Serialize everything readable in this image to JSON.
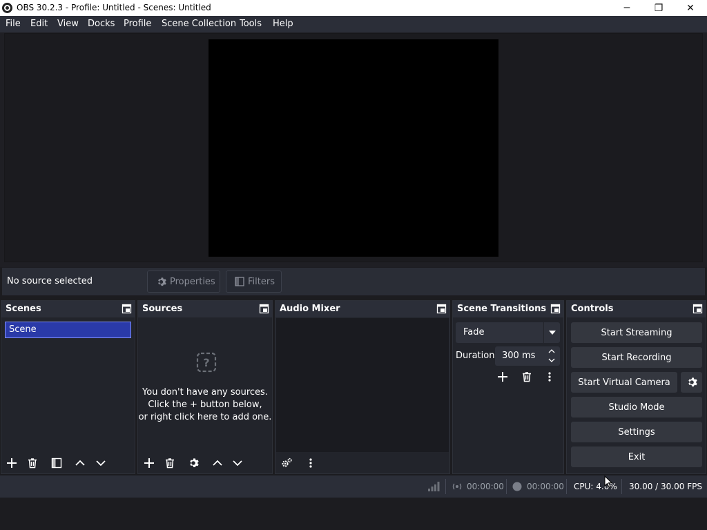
{
  "window": {
    "title": "OBS 30.2.3 - Profile: Untitled - Scenes: Untitled",
    "minimize": "─",
    "maximize": "❐",
    "close": "✕"
  },
  "menu": [
    "File",
    "Edit",
    "View",
    "Docks",
    "Profile",
    "Scene Collection",
    "Tools",
    "Help"
  ],
  "context_bar": {
    "no_source": "No source selected",
    "properties": "Properties",
    "filters": "Filters"
  },
  "scenes": {
    "title": "Scenes",
    "items": [
      "Scene"
    ]
  },
  "sources": {
    "title": "Sources",
    "empty_line1": "You don't have any sources.",
    "empty_line2": "Click the + button below,",
    "empty_line3": "or right click here to add one."
  },
  "audio_mixer": {
    "title": "Audio Mixer"
  },
  "transitions": {
    "title": "Scene Transitions",
    "selected": "Fade",
    "duration_label": "Duration",
    "duration_value": "300 ms"
  },
  "controls": {
    "title": "Controls",
    "start_streaming": "Start Streaming",
    "start_recording": "Start Recording",
    "start_virtual_camera": "Start Virtual Camera",
    "studio_mode": "Studio Mode",
    "settings": "Settings",
    "exit": "Exit"
  },
  "status": {
    "stream_time": "00:00:00",
    "record_time": "00:00:00",
    "cpu": "CPU: 4.0%",
    "fps": "30.00 / 30.00 FPS"
  },
  "colors": {
    "selection": "#2a3aa8",
    "selection_border": "#8090ff",
    "panel": "#22242b",
    "header": "#2b2e38",
    "button": "#34373f"
  }
}
